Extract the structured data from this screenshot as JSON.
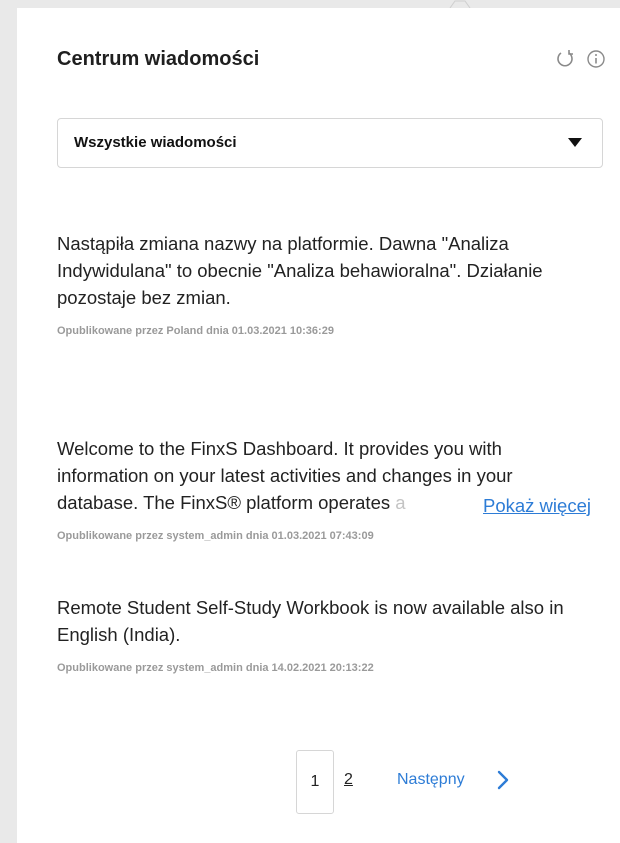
{
  "header": {
    "title": "Centrum wiadomości",
    "icons": [
      "refresh-icon",
      "info-icon"
    ]
  },
  "filter": {
    "selected": "Wszystkie wiadomości"
  },
  "messages": [
    {
      "text": "Nastąpiła zmiana nazwy na platformie. Dawna \"Analiza Indywidulana\" to obecnie \"Analiza behawioralna\". Działanie pozostaje bez zmian.",
      "meta": "Opublikowane przez Poland dnia 01.03.2021 10:36:29"
    },
    {
      "text_line1": "Welcome to the FinxS Dashboard. It provides you with",
      "text_line2": "information on your latest activities and changes in your",
      "text_line3": "database. The FinxS® platform operates ",
      "text_line3_faded": "a",
      "more_label": "Pokaż więcej",
      "meta": "Opublikowane przez system_admin dnia 01.03.2021 07:43:09"
    },
    {
      "text": "Remote Student Self-Study Workbook is now available also in English (India).",
      "meta": "Opublikowane przez system_admin dnia 14.02.2021 20:13:22"
    }
  ],
  "pagination": {
    "current_page": "1",
    "other_page": "2",
    "next_label": "Następny"
  },
  "colors": {
    "accent": "#2d7cd6",
    "meta_text": "#9a9a9a",
    "border": "#d6d6d6"
  }
}
